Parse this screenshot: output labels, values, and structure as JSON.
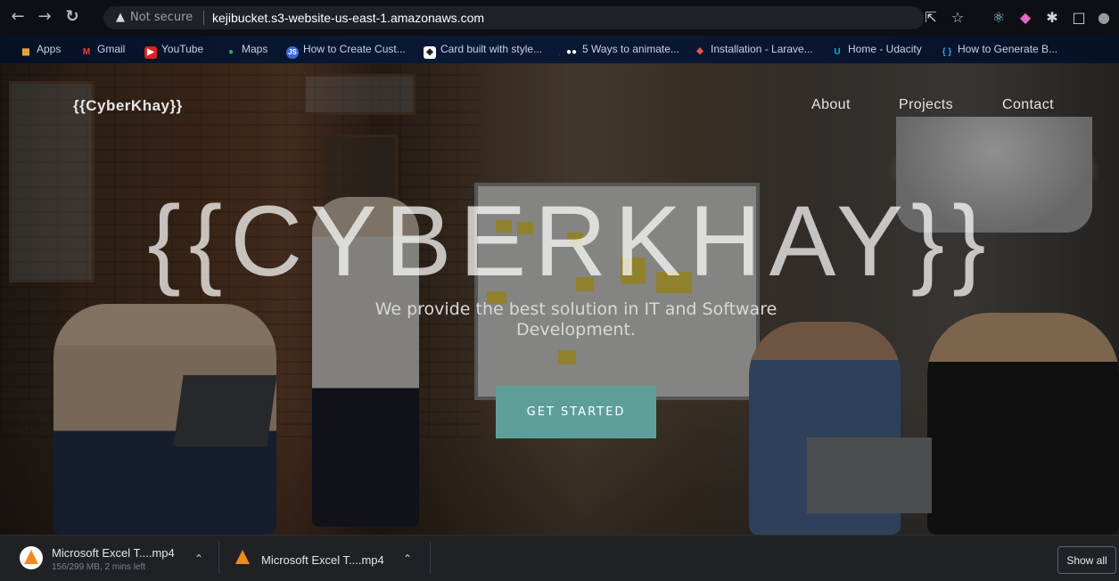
{
  "browser": {
    "security_label": "Not secure",
    "url": "kejibucket.s3-website-us-east-1.amazonaws.com",
    "bookmarks": [
      {
        "label": "Apps",
        "icon": "apps-grid-icon"
      },
      {
        "label": "Gmail",
        "icon": "gmail-icon"
      },
      {
        "label": "YouTube",
        "icon": "youtube-icon"
      },
      {
        "label": "Maps",
        "icon": "maps-icon"
      },
      {
        "label": "How to Create Cust...",
        "icon": "js-icon"
      },
      {
        "label": "Card built with style...",
        "icon": "codepen-icon"
      },
      {
        "label": "5 Ways to animate...",
        "icon": "dots-icon"
      },
      {
        "label": "Installation - Larave...",
        "icon": "laravel-icon"
      },
      {
        "label": "Home - Udacity",
        "icon": "udacity-icon"
      },
      {
        "label": "How to Generate B...",
        "icon": "braces-icon"
      }
    ]
  },
  "site": {
    "logo": "{{CyberKhay}}",
    "nav": [
      "About",
      "Projects",
      "Contact"
    ],
    "hero_title": "{{CYBERKHAY}}",
    "tagline": "We provide the best solution in IT and Software Development.",
    "cta": "GET STARTED"
  },
  "downloads": {
    "items": [
      {
        "name": "Microsoft Excel T....mp4",
        "status": "156/299 MB, 2 mins left"
      },
      {
        "name": "Microsoft Excel T....mp4",
        "status": ""
      }
    ],
    "show_all": "Show all"
  },
  "colors": {
    "cta_bg": "#5e9e98",
    "chrome_bg": "#0d0f14",
    "download_bar": "#1f2125"
  }
}
